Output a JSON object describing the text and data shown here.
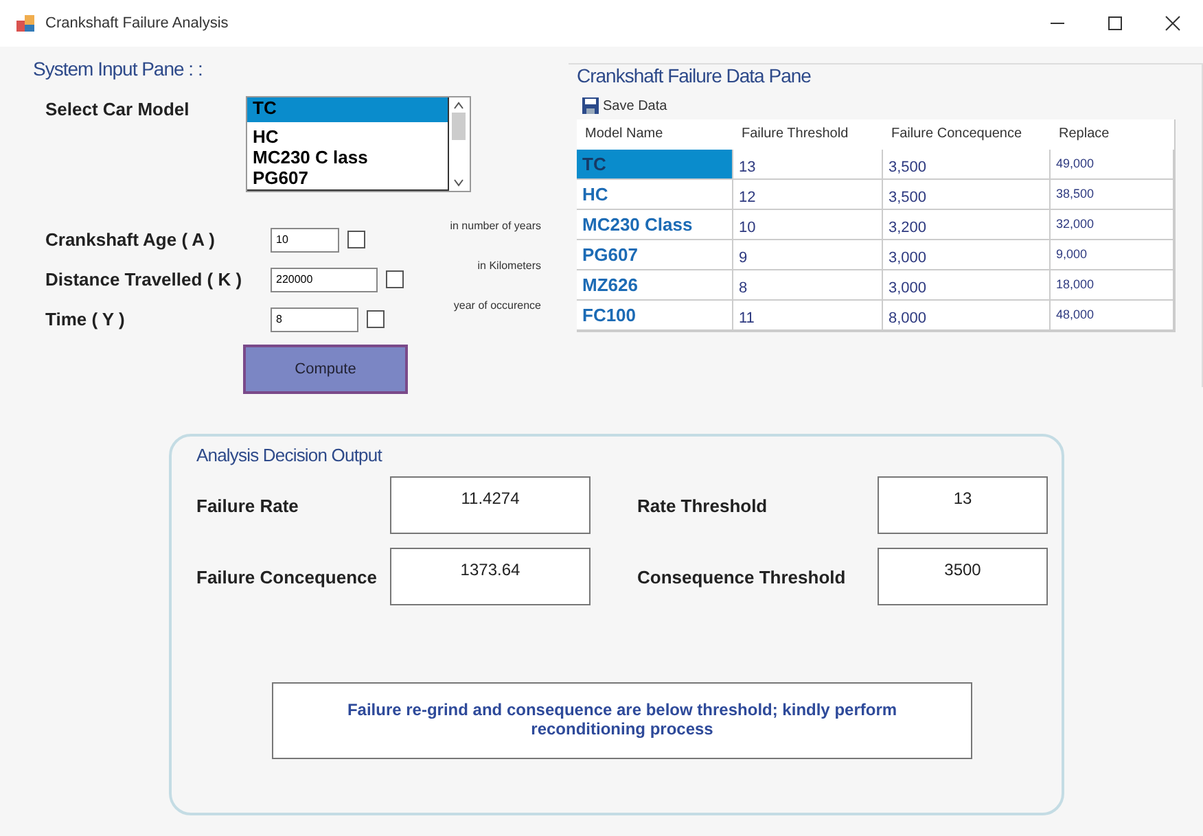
{
  "window": {
    "title": "Crankshaft Failure Analysis"
  },
  "input_pane": {
    "title": "System Input Pane : :",
    "model_label": "Select Car Model",
    "models": [
      {
        "label": "TC",
        "selected": true
      },
      {
        "label": "HC",
        "selected": false
      },
      {
        "label": "MC230 C lass",
        "selected": false
      },
      {
        "label": "PG607",
        "selected": false
      }
    ],
    "fields": [
      {
        "label": "Crankshaft Age ( A )",
        "value": "10",
        "checked": false,
        "unit": "in number of years"
      },
      {
        "label": "Distance Travelled ( K )",
        "value": "220000",
        "checked": false,
        "unit": "in Kilometers"
      },
      {
        "label": "Time ( Y )",
        "value": "8",
        "checked": false,
        "unit": "year of occurence"
      }
    ],
    "compute_button": "Compute"
  },
  "data_pane": {
    "title": "Crankshaft Failure Data Pane",
    "save_button": "Save Data",
    "columns": [
      "Model Name",
      "Failure Threshold",
      "Failure Concequence",
      "Replace"
    ],
    "rows": [
      {
        "cells": [
          "TC",
          "13",
          "3,500",
          "49,000"
        ],
        "selected": true
      },
      {
        "cells": [
          "HC",
          "12",
          "3,500",
          "38,500"
        ],
        "selected": false
      },
      {
        "cells": [
          "MC230 Class",
          "10",
          "3,200",
          "32,000"
        ],
        "selected": false
      },
      {
        "cells": [
          "PG607",
          "9",
          "3,000",
          "9,000"
        ],
        "selected": false
      },
      {
        "cells": [
          "MZ626",
          "8",
          "3,000",
          "18,000"
        ],
        "selected": false
      },
      {
        "cells": [
          "FC100",
          "11",
          "8,000",
          "48,000"
        ],
        "selected": false
      }
    ]
  },
  "output": {
    "title": "Analysis Decision Output",
    "results": [
      {
        "label": "Failure Rate",
        "value": "11.4274"
      },
      {
        "label": "Rate Threshold",
        "value": "13"
      },
      {
        "label": "Failure Concequence",
        "value": "1373.64"
      },
      {
        "label": "Consequence Threshold",
        "value": "3500"
      }
    ],
    "message": "Failure re-grind and consequence are below threshold; kindly perform reconditioning process"
  }
}
